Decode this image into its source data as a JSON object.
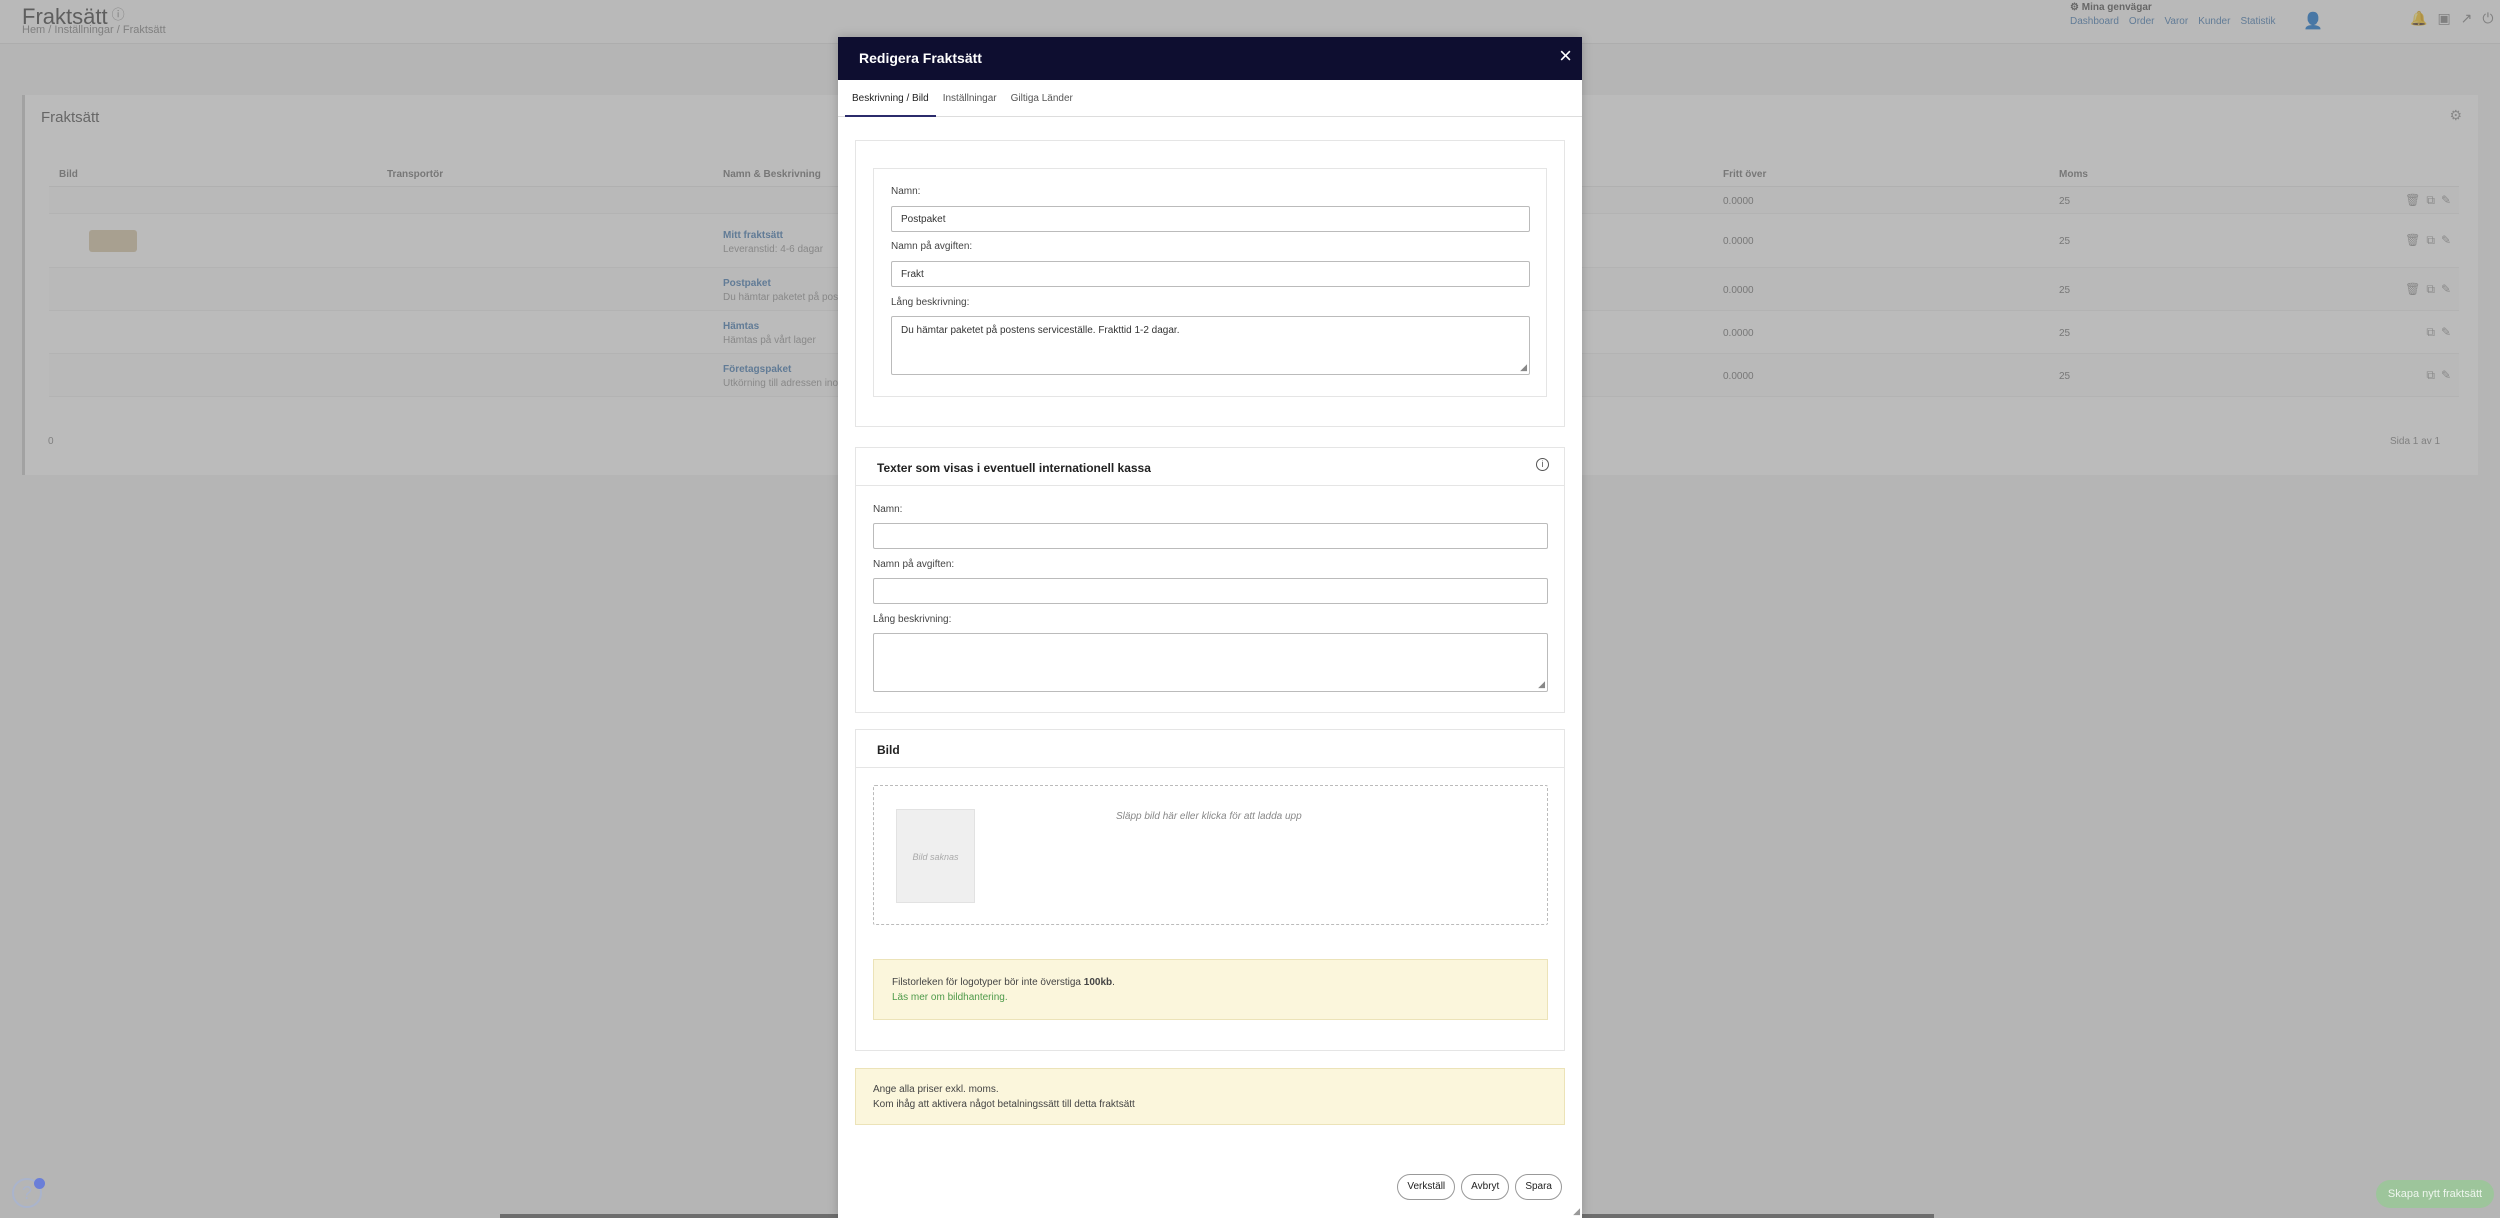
{
  "page": {
    "title": "Fraktsätt",
    "breadcrumb": "Hem / Inställningar / Fraktsätt",
    "shortcuts_title": "Mina genvägar",
    "shortcuts": [
      "Dashboard",
      "Order",
      "Varor",
      "Kunder",
      "Statistik"
    ]
  },
  "panel": {
    "title": "Fraktsätt",
    "columns": [
      "Bild",
      "Transportör",
      "Namn & Beskrivning",
      "Fritt över",
      "Moms"
    ],
    "rows": [
      {
        "name": "",
        "desc": "",
        "free": "0.0000",
        "vat": "25"
      },
      {
        "name": "Mitt fraktsätt",
        "desc": "Leveranstid: 4-6 dagar",
        "free": "0.0000",
        "vat": "25"
      },
      {
        "name": "Postpaket",
        "desc": "Du hämtar paketet på posten",
        "free": "0.0000",
        "vat": "25"
      },
      {
        "name": "Hämtas",
        "desc": "Hämtas på vårt lager",
        "free": "0.0000",
        "vat": "25"
      },
      {
        "name": "Företagspaket",
        "desc": "Utkörning till adressen inom",
        "free": "0.0000",
        "vat": "25"
      }
    ],
    "pager_left": "0",
    "pager_right": "Sida 1 av 1"
  },
  "floating": {
    "help": "?",
    "green_button": "Skapa nytt fraktsätt"
  },
  "modal": {
    "title": "Redigera Fraktsätt",
    "close_icon": "×",
    "tabs": [
      "Beskrivning / Bild",
      "Inställningar",
      "Giltiga Länder"
    ],
    "description": {
      "name_label": "Namn:",
      "name_value": "Postpaket",
      "fee_label": "Namn på avgiften:",
      "fee_value": "Frakt",
      "long_label": "Lång beskrivning:",
      "long_value": "Du hämtar paketet på postens serviceställe. Frakttid 1-2 dagar."
    },
    "international": {
      "title": "Texter som visas i eventuell internationell kassa",
      "info_icon": "i",
      "name_label": "Namn:",
      "name_value": "",
      "fee_label": "Namn på avgiften:",
      "fee_value": "",
      "long_label": "Lång beskrivning:",
      "long_value": ""
    },
    "image": {
      "title": "Bild",
      "placeholder": "Bild saknas",
      "drop_text": "Släpp bild här eller klicka för att ladda upp",
      "note_prefix": "Filstorleken för logotyper bör inte överstiga ",
      "note_bold": "100kb",
      "note_suffix": ".",
      "note_link": "Läs mer om bildhantering."
    },
    "notice": {
      "line1": "Ange alla priser exkl. moms.",
      "line2": "Kom ihåg att aktivera något betalningssätt till detta fraktsätt"
    },
    "buttons": {
      "apply": "Verkställ",
      "cancel": "Avbryt",
      "save": "Spara"
    }
  }
}
